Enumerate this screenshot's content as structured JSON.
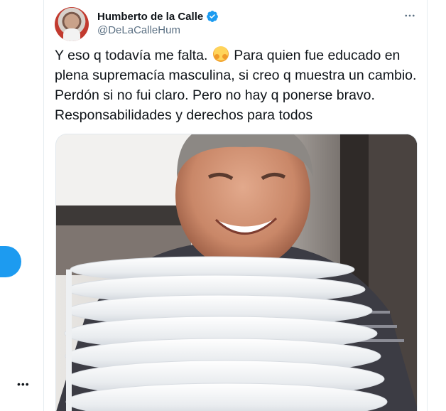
{
  "author": {
    "display_name": "Humberto de la Calle",
    "handle": "@DeLaCalleHum",
    "verified": true
  },
  "tweet": {
    "text_before_emoji": "Y eso q todavía me falta.",
    "emoji": "hugging-face-emoji",
    "text_after_emoji": "Para quien fue educado en plena supremacía masculina, si creo q muestra un cambio. Perdón si no fui claro. Pero no hay q ponerse bravo. Responsabilidades y derechos para todos"
  },
  "media": {
    "description_icon": "photo"
  },
  "icons": {
    "more": "more-horizontal-icon",
    "verified": "verified-badge-icon"
  },
  "left_rail": {
    "more_label": "•••"
  },
  "colors": {
    "accent": "#1d9bf0",
    "secondary_text": "#5b7083",
    "border": "#e6ecf0"
  }
}
